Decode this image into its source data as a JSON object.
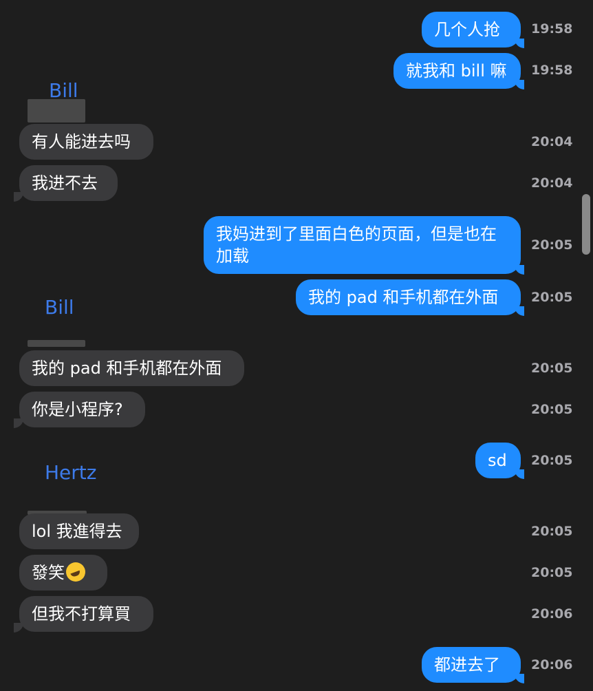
{
  "messages": [
    {
      "type": "out",
      "text": "几个人抢",
      "time": "19:58"
    },
    {
      "type": "out",
      "text": "就我和 bill 嘛",
      "time": "19:58"
    },
    {
      "type": "sender",
      "name": "Bill"
    },
    {
      "type": "in",
      "text": "有人能进去吗",
      "time": "20:04"
    },
    {
      "type": "in",
      "text": "我进不去",
      "time": "20:04"
    },
    {
      "type": "out",
      "text": "我妈进到了里面白色的页面，但是也在加载",
      "time": "20:05"
    },
    {
      "type": "out",
      "text": "我的 pad 和手机都在外面",
      "time": "20:05"
    },
    {
      "type": "sender",
      "name": "Bill"
    },
    {
      "type": "in",
      "text": "我的 pad 和手机都在外面",
      "time": "20:05"
    },
    {
      "type": "in",
      "text": "你是小程序?",
      "time": "20:05"
    },
    {
      "type": "out",
      "text": "sd",
      "time": "20:05"
    },
    {
      "type": "sender",
      "name": "Hertz"
    },
    {
      "type": "in",
      "text": "lol 我進得去",
      "time": "20:05"
    },
    {
      "type": "in",
      "text": "發笑",
      "emoji": "rolling-on-floor-laughing-emoji",
      "time": "20:05"
    },
    {
      "type": "in",
      "text": "但我不打算買",
      "time": "20:06"
    },
    {
      "type": "out",
      "text": "都进去了",
      "time": "20:06"
    }
  ],
  "colors": {
    "background": "#1e1e1e",
    "outgoing_bubble": "#1f8cff",
    "incoming_bubble": "#3a3a3c",
    "sender_name": "#3d7bea",
    "timestamp": "#a9a9ae"
  }
}
